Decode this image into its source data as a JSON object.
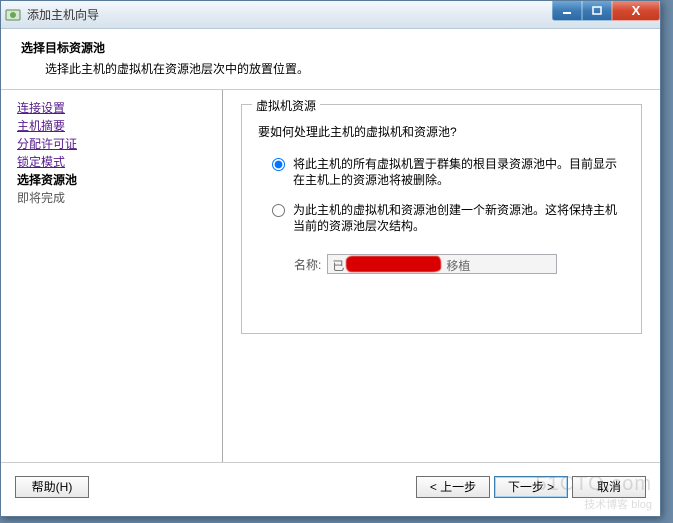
{
  "window": {
    "title": "添加主机向导"
  },
  "header": {
    "title": "选择目标资源池",
    "desc": "选择此主机的虚拟机在资源池层次中的放置位置。"
  },
  "sidebar": {
    "items": [
      {
        "label": "连接设置",
        "state": "link"
      },
      {
        "label": "主机摘要",
        "state": "link"
      },
      {
        "label": "分配许可证",
        "state": "link"
      },
      {
        "label": "锁定模式",
        "state": "link"
      },
      {
        "label": "选择资源池",
        "state": "current"
      },
      {
        "label": "即将完成",
        "state": "pending"
      }
    ]
  },
  "content": {
    "group_title": "虚拟机资源",
    "question": "要如何处理此主机的虚拟机和资源池?",
    "option1": "将此主机的所有虚拟机置于群集的根目录资源池中。目前显示在主机上的资源池将被删除。",
    "option2": "为此主机的虚拟机和资源池创建一个新资源池。这将保持主机当前的资源池层次结构。",
    "name_label": "名称:",
    "name_value_prefix": "已",
    "name_value_suffix": "移植"
  },
  "footer": {
    "help": "帮助(H)",
    "back": "< 上一步",
    "next": "下一步 >",
    "cancel": "取消"
  },
  "watermark": {
    "line1": "51CTO.com",
    "line2": "技术博客 blog"
  }
}
